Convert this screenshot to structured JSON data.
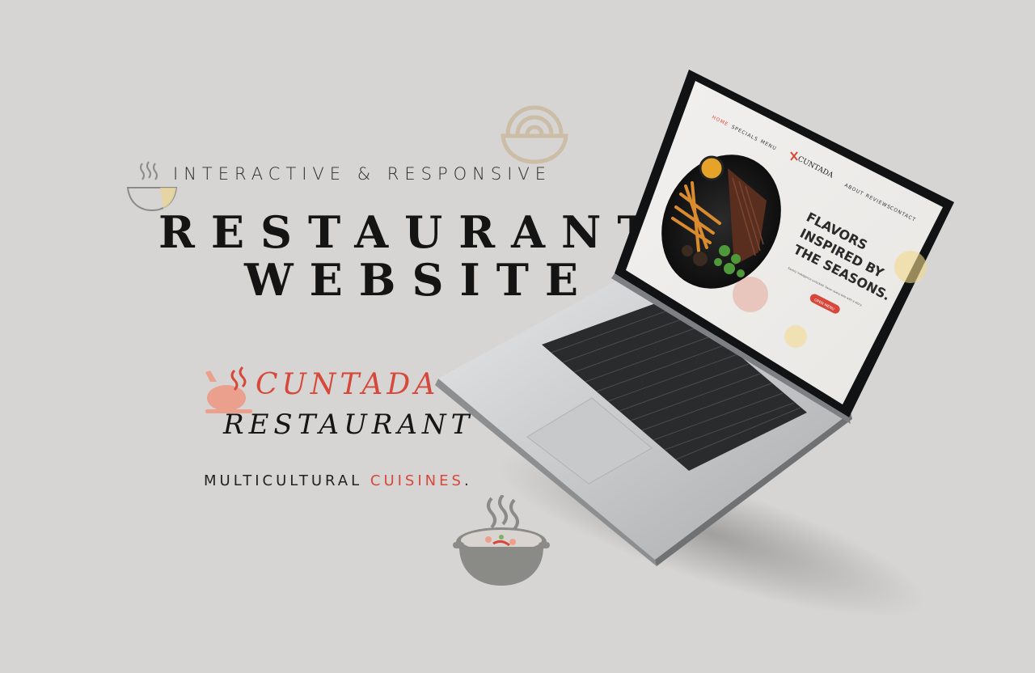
{
  "hero": {
    "tagline": "INTERACTIVE & RESPONSIVE",
    "headline_line1": "RESTAURANT",
    "headline_line2": "WEBSITE"
  },
  "brand": {
    "name": "CUNTADA",
    "subtitle": "RESTAURANT",
    "tagline_prefix": "MULTICULTURAL",
    "tagline_accent": "CUISINES",
    "tagline_suffix": "."
  },
  "screen": {
    "nav_left": [
      "HOME",
      "SPECIALS",
      "MENU"
    ],
    "nav_right": [
      "ABOUT",
      "REVIEWS",
      "CONTACT"
    ],
    "logo": "CUNTADA",
    "hero_title_lines": [
      "FLAVORS",
      "INSPIRED BY",
      "THE SEASONS."
    ],
    "hero_body": "Savory indulgence unlocked. Savor every bite with a story.",
    "cta_label": "OPEN MENU"
  },
  "icons": {
    "bowl_top": "ramen-bowl-icon",
    "bowl_left": "steaming-bowl-icon",
    "chicken": "roast-chicken-icon",
    "pot": "soup-pot-icon"
  },
  "colors": {
    "background": "#d6d5d3",
    "accent": "#d7483a",
    "text_dark": "#141414",
    "icon_tan": "#c9b89c",
    "icon_gray": "#8a8a86"
  }
}
